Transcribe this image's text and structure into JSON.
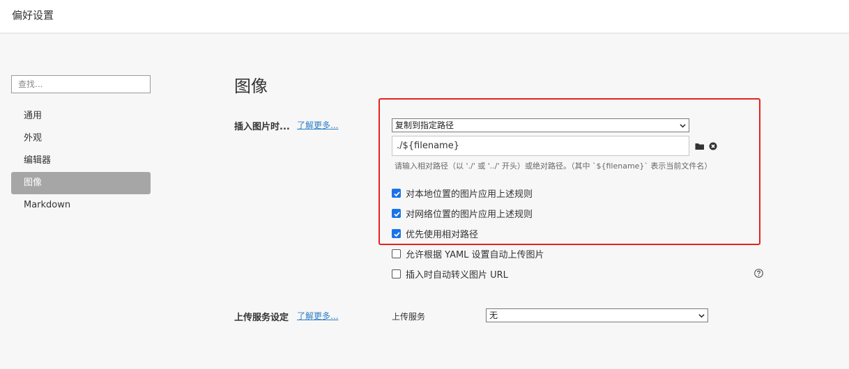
{
  "window": {
    "title": "偏好设置"
  },
  "sidebar": {
    "search_placeholder": "查找...",
    "items": [
      {
        "label": "通用"
      },
      {
        "label": "外观"
      },
      {
        "label": "编辑器"
      },
      {
        "label": "图像",
        "active": true
      },
      {
        "label": "Markdown"
      }
    ]
  },
  "main": {
    "title": "图像",
    "insert_image": {
      "label": "插入图片时...",
      "learn_more": "了解更多...",
      "action_select": "复制到指定路径",
      "path_value": "./${filename}",
      "path_hint": "请输入相对路径（以 './' 或 '../' 开头）或绝对路径。（其中 `${filename}` 表示当前文件名）",
      "folder_icon": "folder-icon",
      "clear_icon": "close-circle-icon",
      "options": [
        {
          "label": "对本地位置的图片应用上述规则",
          "checked": true
        },
        {
          "label": "对网络位置的图片应用上述规则",
          "checked": true
        },
        {
          "label": "优先使用相对路径",
          "checked": true
        },
        {
          "label": "允许根据 YAML 设置自动上传图片",
          "checked": false
        },
        {
          "label": "插入时自动转义图片 URL",
          "checked": false
        }
      ],
      "help_icon": "help-circle-icon"
    },
    "upload_service": {
      "label": "上传服务设定",
      "learn_more": "了解更多...",
      "service_label": "上传服务",
      "service_select": "无"
    },
    "highlight_color": "#e8201c",
    "accent_color": "#1a73e8"
  }
}
